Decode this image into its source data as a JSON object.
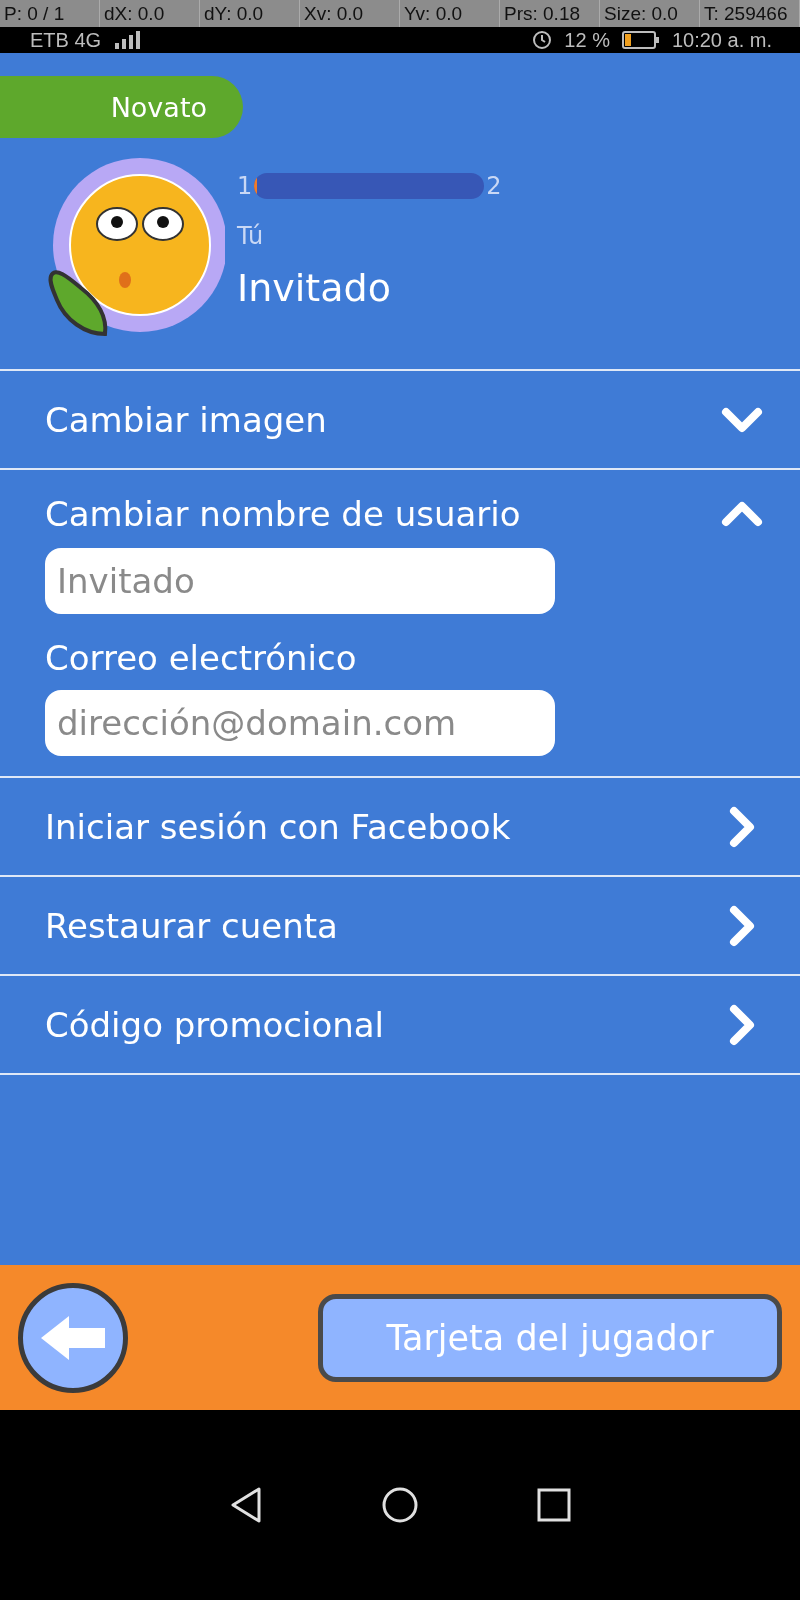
{
  "debug_overlay": [
    "P: 0 / 1",
    "dX: 0.0",
    "dY: 0.0",
    "Xv: 0.0",
    "Yv: 0.0",
    "Prs: 0.18",
    "Size: 0.0",
    "T: 259466"
  ],
  "status_bar": {
    "carrier": "ETB 4G",
    "battery": "12 %",
    "time": "10:20 a. m."
  },
  "profile": {
    "rank": "Novato",
    "level_from": "1",
    "level_to": "2",
    "level": 0.01,
    "subtitle": "Tú",
    "name": "Invitado"
  },
  "menu": [
    {
      "kind": "toggle",
      "label": "Cambiar imagen",
      "expanded": false
    },
    {
      "kind": "toggle",
      "label": "Cambiar nombre de usuario",
      "expanded": true,
      "fields": [
        {
          "placeholder": "Invitado"
        },
        {
          "label": "Correo electrónico",
          "placeholder": "dirección@domain.com"
        }
      ]
    },
    {
      "kind": "link",
      "label": "Iniciar sesión con Facebook"
    },
    {
      "kind": "link",
      "label": "Restaurar cuenta"
    },
    {
      "kind": "link",
      "label": "Código promocional"
    }
  ],
  "bottom_bar": {
    "primary_button": "Tarjeta del jugador"
  }
}
